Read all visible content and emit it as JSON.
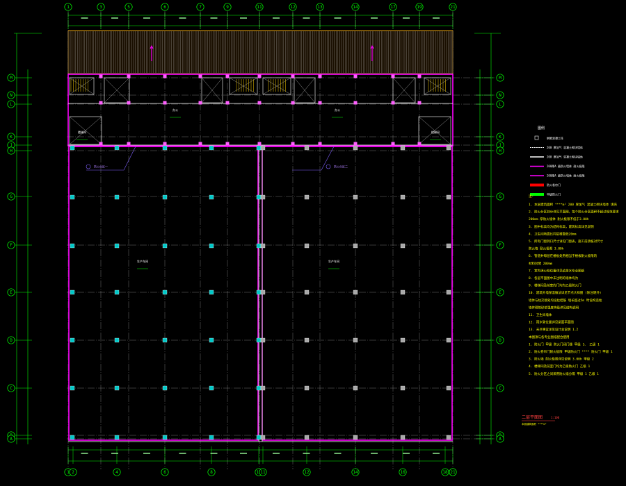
{
  "grid_labels": {
    "top": [
      "1",
      "3",
      "5",
      "6",
      "7",
      "9",
      "11",
      "12",
      "13",
      "14",
      "17",
      "19",
      "21"
    ],
    "bottom": [
      "1",
      "2",
      "4",
      "6",
      "8",
      "10",
      "11",
      "12",
      "14",
      "16",
      "18",
      "20",
      "21"
    ],
    "left": [
      "M",
      "N",
      "L",
      "K",
      "J",
      "H",
      "G",
      "F",
      "E",
      "D",
      "C",
      "B",
      "A"
    ],
    "right": [
      "M",
      "N",
      "L",
      "K",
      "J",
      "H",
      "G",
      "F",
      "E",
      "D",
      "C",
      "B",
      "A"
    ]
  },
  "legend": {
    "title": "图例",
    "entries": [
      {
        "swatch": "column",
        "color": "#dddddd",
        "label": "钢筋混凝土柱"
      },
      {
        "swatch": "dashed",
        "color": "#ffffff",
        "label": "200 厚加气 混凝土砌块墙体"
      },
      {
        "swatch": "line",
        "color": "#ffffff",
        "label": "200 厚加气 混凝土砌块墙体"
      },
      {
        "swatch": "line",
        "color": "#ff00ff",
        "label": "200厚A 级防火墙体 耐火极限"
      },
      {
        "swatch": "line",
        "color": "#ff00ff",
        "label": "200厚A 级防火墙体 耐火极限"
      },
      {
        "swatch": "fill",
        "color": "#ff0000",
        "label": "防火卷帘门"
      },
      {
        "swatch": "fill",
        "color": "#00ff00",
        "label": "甲级防火门"
      }
    ]
  },
  "notes_heading": "注:",
  "notes": [
    "1. 本层建筑面积 ****m² 200 厚加气 混凝土砌块墙体 填充",
    "2. 防火分区划分详见平面图，每个防火分区面积不超过规范要求",
    "200mm 厚防火墙体 耐火极限不低于3.00h",
    "3. 图中标高均为结构标高，建筑标高详见说明",
    "4. 卫生间地面比同层楼面低20mm",
    "5. 所有门窗洞口尺寸详见门窗表，施工前须核对尺寸",
    "防火墙 耐火极限 3.00h",
    "6. 管道井每层在楼板处用相当于楼板耐火极限的",
    "材料封堵 200mm",
    "7. 室内消火栓位置详见给排水专业图纸",
    "8. 各层平面图中未注明的墙体均为",
    "9. 楼梯间及前室的门均为乙级防火门",
    "10. 建筑外墙保温做法详见节点大样图 (除注明外)",
    "墙体与柱交接处均设拉结筋 墙长超过5m 时设构造柱",
    "墙体砌筑砂浆强度等级详见结构说明",
    "11. 卫生间墙体",
    "12. 雨水管位置详见屋面平面图",
    "13. 未尽事宜详见设计总说明 1.2",
    "本图须与各专业图纸配合使用",
    "1. 防火门 甲级 防火门闭门器 甲级 1、 乙级 1",
    "2. 防火卷帘门耐火极限 甲级防火门 ****  防火门 甲级 1",
    "3. 防火墙 耐火极限详见说明 3.00h 甲级 2",
    "4. 楼梯间及前室门均为乙级防火门 乙级 1",
    "5. 防火分区之间采用防火墙分隔 甲级 1 乙级 1"
  ],
  "drawing_title": "二层平面图",
  "drawing_scale": "1:100",
  "drawing_subtitle": "本层建筑面积 ****m²",
  "room_labels": [
    {
      "name": "room-upper-left",
      "text": "办公"
    },
    {
      "name": "room-upper-right",
      "text": "办公"
    },
    {
      "name": "room-hall-left",
      "text": "生产车间"
    },
    {
      "name": "room-hall-right",
      "text": "生产车间"
    },
    {
      "name": "room-stair-left",
      "text": "楼梯间"
    },
    {
      "name": "room-stair-right",
      "text": "楼梯间"
    }
  ],
  "fire_zone_labels": [
    "防火分区一",
    "防火分区二"
  ],
  "colors": {
    "background": "#000000",
    "grid": "#00ff00",
    "wall": "#ff00ff",
    "column": "#00c8c8",
    "axis": "#ffffff",
    "note": "#ffff00",
    "dim": "#00ff00"
  }
}
